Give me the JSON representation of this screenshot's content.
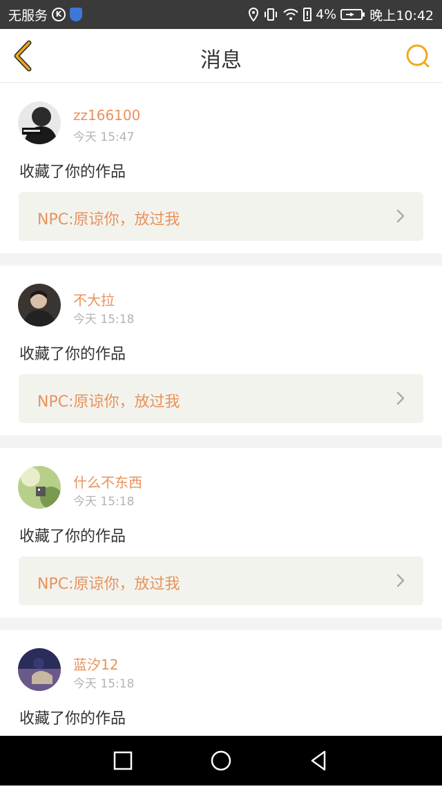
{
  "status_bar": {
    "carrier": "无服务",
    "battery_percent": "4%",
    "time": "晚上10:42",
    "icons": [
      "k-icon",
      "shield-icon",
      "location-icon",
      "vibrate-icon",
      "wifi-icon",
      "battery-alert-icon",
      "battery-icon"
    ]
  },
  "header": {
    "title": "消息",
    "back_icon": "back-chevron-icon",
    "search_icon": "search-icon"
  },
  "messages": [
    {
      "username": "zz166100",
      "time": "今天 15:47",
      "action": "收藏了你的作品",
      "work_title": "NPC:原谅你，放过我"
    },
    {
      "username": "不大拉",
      "time": "今天 15:18",
      "action": "收藏了你的作品",
      "work_title": "NPC:原谅你，放过我"
    },
    {
      "username": "什么不东西",
      "time": "今天 15:18",
      "action": "收藏了你的作品",
      "work_title": "NPC:原谅你，放过我"
    },
    {
      "username": "蓝汐12",
      "time": "今天 15:18",
      "action": "收藏了你的作品",
      "work_title": ""
    }
  ],
  "nav_bar": {
    "icons": [
      "recent-apps-icon",
      "home-icon",
      "back-icon"
    ]
  },
  "colors": {
    "accent": "#e8925a",
    "header_icon": "#f0a81c",
    "card_link_bg": "#f3f3ee"
  }
}
